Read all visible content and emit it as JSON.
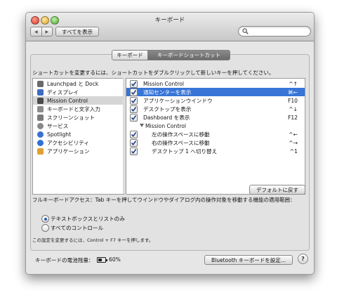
{
  "window": {
    "title": "キーボード"
  },
  "toolbar": {
    "back_label": "◀",
    "forward_label": "▶",
    "show_all_label": "すべてを表示",
    "search_placeholder": ""
  },
  "tabs": [
    {
      "label": "キーボード",
      "selected": false
    },
    {
      "label": "キーボードショートカット",
      "selected": true
    }
  ],
  "instruction": "ショートカットを変更するには、ショートカットをダブルクリックして新しいキーを押してください。",
  "categories": [
    {
      "label": "Launchpad と Dock",
      "icon": "launchpad-icon",
      "color": "#6a6a6a",
      "selected": false
    },
    {
      "label": "ディスプレイ",
      "icon": "display-icon",
      "color": "#3d6bbf",
      "selected": false
    },
    {
      "label": "Mission Control",
      "icon": "mission-control-icon",
      "color": "#4a4a4a",
      "selected": true
    },
    {
      "label": "キーボードと文字入力",
      "icon": "keyboard-icon",
      "color": "#8c8c8c",
      "selected": false
    },
    {
      "label": "スクリーンショット",
      "icon": "screenshot-icon",
      "color": "#7a7a7a",
      "selected": false
    },
    {
      "label": "サービス",
      "icon": "services-gear-icon",
      "color": "#888888",
      "selected": false
    },
    {
      "label": "Spotlight",
      "icon": "spotlight-icon",
      "color": "#3b6fd0",
      "selected": false
    },
    {
      "label": "アクセシビリティ",
      "icon": "accessibility-icon",
      "color": "#2f6fd6",
      "selected": false
    },
    {
      "label": "アプリケーション",
      "icon": "applications-icon",
      "color": "#e0a030",
      "selected": false
    }
  ],
  "shortcuts": [
    {
      "name": "Mission Control",
      "key": "^↑",
      "checked": true,
      "indent": 0,
      "group": false,
      "selected": false
    },
    {
      "name": "通知センターを表示",
      "key": "⌘←",
      "checked": true,
      "indent": 0,
      "group": false,
      "selected": true
    },
    {
      "name": "アプリケーションウインドウ",
      "key": "F10",
      "checked": true,
      "indent": 0,
      "group": false,
      "selected": false
    },
    {
      "name": "デスクトップを表示",
      "key": "^↓",
      "checked": true,
      "indent": 0,
      "group": false,
      "selected": false
    },
    {
      "name": "Dashboard を表示",
      "key": "F12",
      "checked": true,
      "indent": 0,
      "group": false,
      "selected": false
    },
    {
      "name": "Mission Control",
      "key": "",
      "checked": false,
      "indent": 0,
      "group": true,
      "selected": false
    },
    {
      "name": "左の操作スペースに移動",
      "key": "^←",
      "checked": true,
      "indent": 1,
      "group": false,
      "selected": false
    },
    {
      "name": "右の操作スペースに移動",
      "key": "^→",
      "checked": true,
      "indent": 1,
      "group": false,
      "selected": false
    },
    {
      "name": "デスクトップ 1 へ切り替え",
      "key": "^1",
      "checked": true,
      "indent": 1,
      "group": false,
      "selected": false
    }
  ],
  "reset_label": "デフォルトに戻す",
  "full_keyboard_access": {
    "text": "フルキーボードアクセス：Tab キーを押してウインドウやダイアログ内の操作対象を移動する機能の適用範囲：",
    "options": [
      {
        "label": "テキストボックスとリストのみ",
        "selected": true
      },
      {
        "label": "すべてのコントロール",
        "selected": false
      }
    ],
    "note": "この設定を変更するには、Control + F7 キーを押します。"
  },
  "footer": {
    "battery_label": "キーボードの電池残量：",
    "battery_percent": "60%",
    "bluetooth_button": "Bluetooth キーボードを設定...",
    "help_label": "?"
  }
}
